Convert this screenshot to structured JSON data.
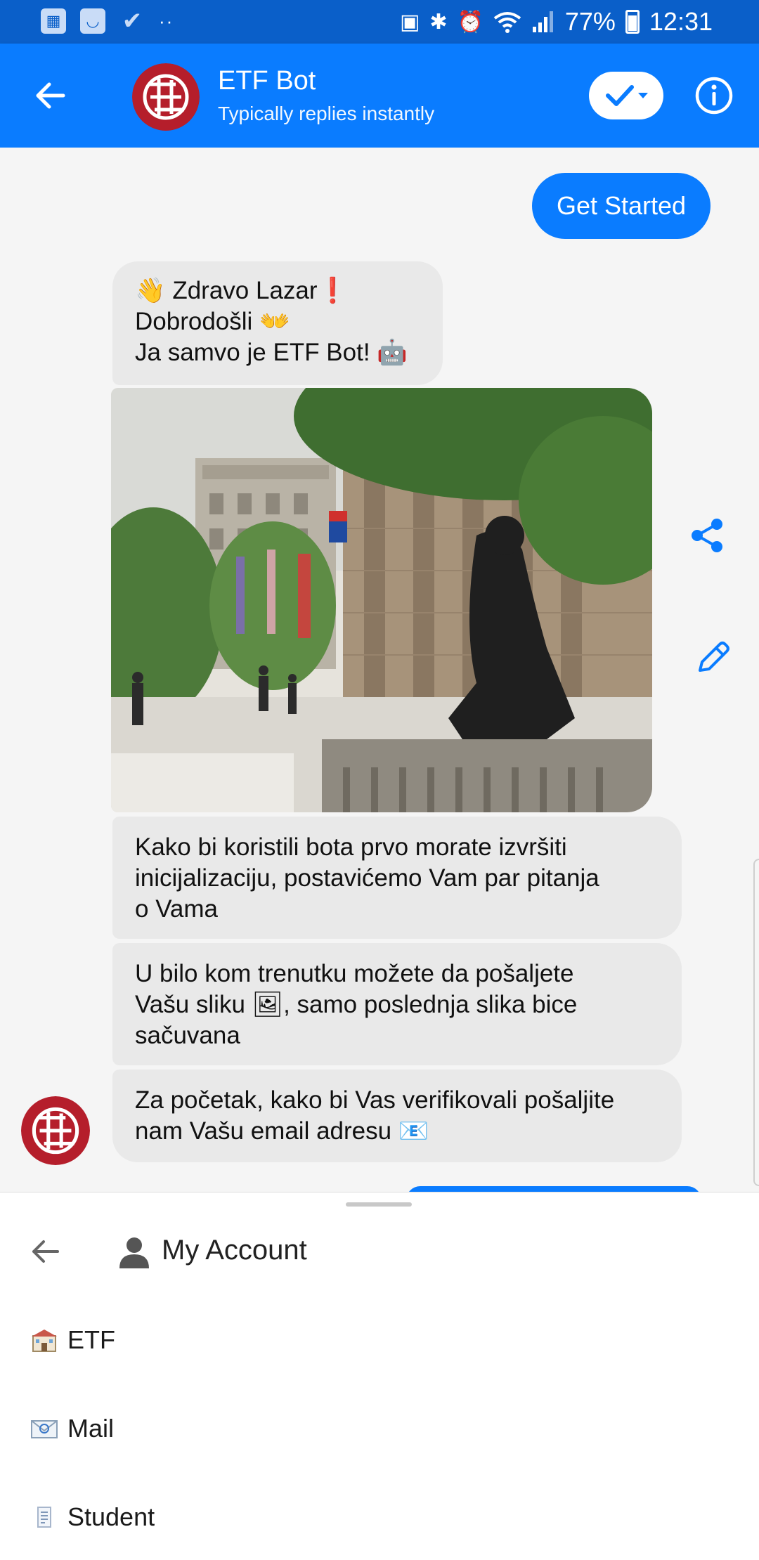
{
  "status_bar": {
    "battery": "77%",
    "time": "12:31",
    "dots": "··"
  },
  "header": {
    "title": "ETF Bot",
    "subtitle": "Typically replies instantly"
  },
  "messages": {
    "user_get_started": "Get Started",
    "greeting": {
      "line1_emoji": "👋",
      "line1_text": " Zdravo Lazar",
      "line1_mark": "❗",
      "line2_text": "Dobrodošli ",
      "line2_emoji": "👐",
      "line3_text": "Ja samvo je ETF Bot! ",
      "line3_emoji": "🤖"
    },
    "init_lines": [
      "Kako bi koristili bota prvo morate izvršiti",
      "inicijalizaciju, postavićemo Vam par pitanja",
      "o Vama"
    ],
    "photo": {
      "line1": "U bilo kom trenutku možete da pošaljete",
      "line2_a": "Vašu sliku ",
      "line2_emoji": "🖼",
      "line2_b": ", samo poslednja slika bice",
      "line3": "sačuvana"
    },
    "email": {
      "line1": "Za početak, kako bi Vas verifikovali pošaljite",
      "line2": "nam Vašu email adresu ",
      "line2_emoji": "📧"
    }
  },
  "menu": {
    "title": "My Account",
    "items": [
      {
        "label": "ETF",
        "icon": "school-icon"
      },
      {
        "label": "Mail",
        "icon": "mail-icon"
      },
      {
        "label": "Student",
        "icon": "document-icon"
      }
    ]
  },
  "colors": {
    "status_bar": "#0a5fc9",
    "header": "#0a7cff",
    "user_bubble": "#0a7cff",
    "bot_bubble": "#e9e9e9",
    "brand_red": "#b51e2b"
  }
}
